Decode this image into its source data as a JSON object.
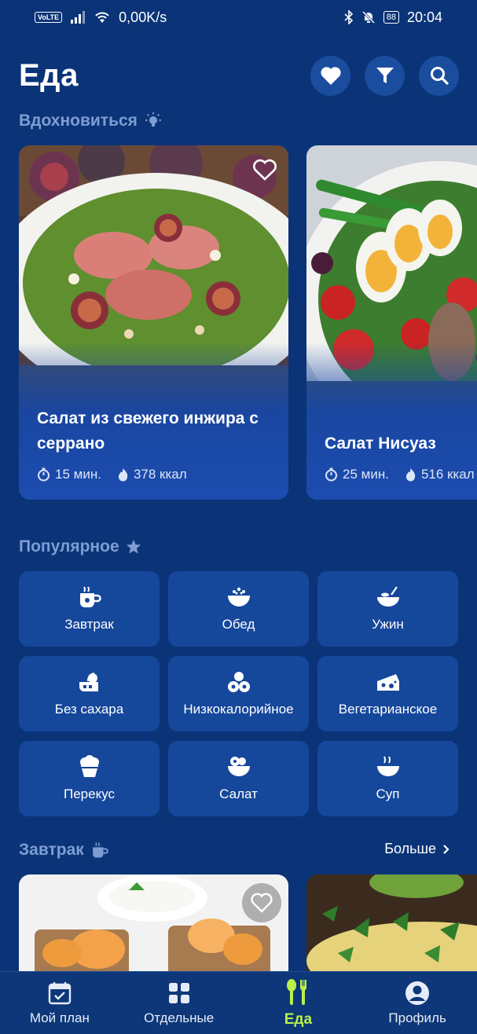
{
  "status_bar": {
    "network_badge": "VoLTE",
    "speed": "0,00K/s",
    "battery": "88",
    "time": "20:04"
  },
  "header": {
    "title": "Еда",
    "icons": [
      "heart-icon",
      "filter-icon",
      "search-icon"
    ]
  },
  "inspire": {
    "label": "Вдохновиться",
    "cards": [
      {
        "title": "Салат из свежего инжира с серрано",
        "time": "15 мин.",
        "kcal": "378 ккал"
      },
      {
        "title": "Салат Нисуаз",
        "time": "25 мин.",
        "kcal": "516 ккал"
      }
    ]
  },
  "popular": {
    "label": "Популярное",
    "items": [
      {
        "label": "Завтрак",
        "icon": "breakfast-cup-icon"
      },
      {
        "label": "Обед",
        "icon": "lunch-bowl-icon"
      },
      {
        "label": "Ужин",
        "icon": "dinner-bowl-icon"
      },
      {
        "label": "Без сахара",
        "icon": "no-sugar-icon"
      },
      {
        "label": "Низкокалорийное",
        "icon": "low-calorie-icon"
      },
      {
        "label": "Вегетарианское",
        "icon": "vegetarian-icon"
      },
      {
        "label": "Перекус",
        "icon": "snack-muffin-icon"
      },
      {
        "label": "Салат",
        "icon": "salad-icon"
      },
      {
        "label": "Суп",
        "icon": "soup-icon"
      }
    ]
  },
  "breakfast": {
    "label": "Завтрак",
    "more": "Больше"
  },
  "nav": {
    "items": [
      {
        "label": "Мой план",
        "icon": "calendar-icon",
        "active": false
      },
      {
        "label": "Отдельные",
        "icon": "grid-icon",
        "active": false
      },
      {
        "label": "Еда",
        "icon": "cutlery-icon",
        "active": true
      },
      {
        "label": "Профиль",
        "icon": "profile-icon",
        "active": false
      }
    ]
  },
  "colors": {
    "background": "#0b3478",
    "tile": "#15479b",
    "section_label": "#7e9ed3",
    "active_nav": "#b8f04a"
  }
}
